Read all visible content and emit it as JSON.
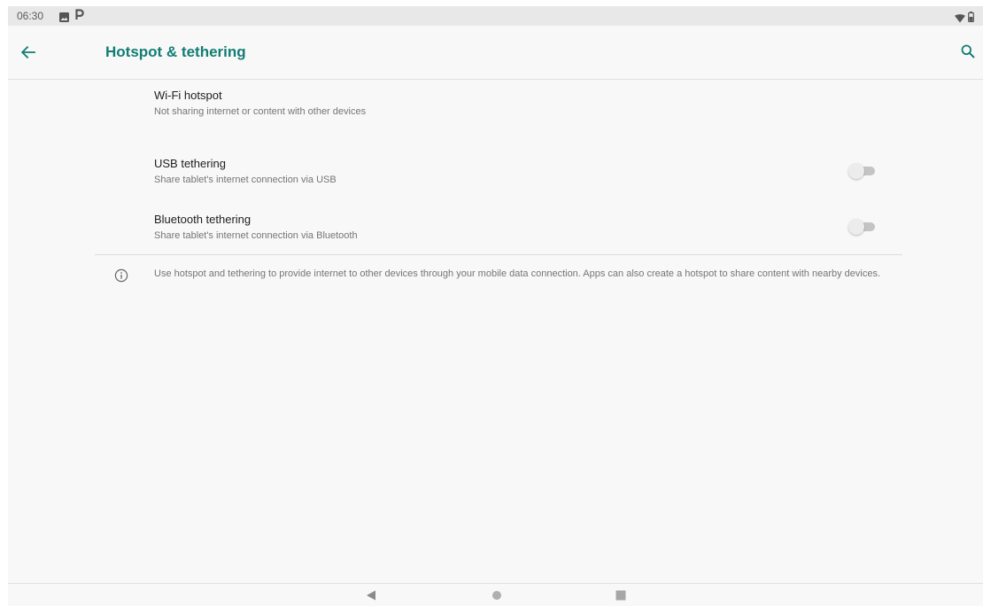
{
  "status_bar": {
    "time": "06:30",
    "icons": [
      "photo-icon",
      "p-icon",
      "wifi-icon",
      "battery-icon"
    ]
  },
  "toolbar": {
    "title": "Hotspot & tethering",
    "back_icon": "arrow-back-icon",
    "search_icon": "search-icon"
  },
  "items": [
    {
      "title": "Wi-Fi hotspot",
      "summary": "Not sharing internet or content with other devices"
    },
    {
      "title": "USB tethering",
      "summary": "Share tablet's internet connection via USB",
      "toggle_on": false
    },
    {
      "title": "Bluetooth tethering",
      "summary": "Share tablet's internet connection via Bluetooth",
      "toggle_on": false
    }
  ],
  "info": {
    "icon": "info-icon",
    "text": "Use hotspot and tethering to provide internet to other devices through your mobile data connection. Apps can also create a hotspot to share content with nearby devices."
  },
  "nav_bar": {
    "icons": [
      "nav-back-icon",
      "nav-home-icon",
      "nav-recents-icon"
    ]
  },
  "colors": {
    "accent": "#127d74",
    "background": "#f8f8f8",
    "status_bar": "#e8e8e8"
  }
}
